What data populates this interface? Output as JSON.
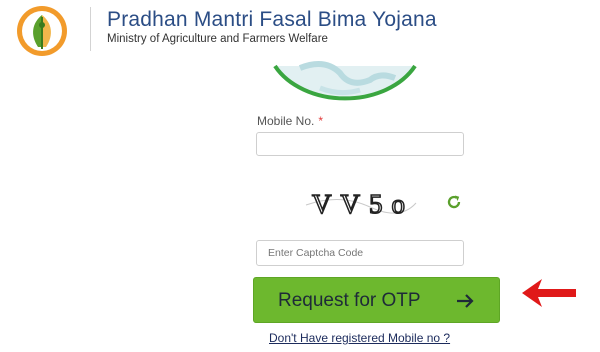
{
  "header": {
    "title": "Pradhan Mantri Fasal Bima Yojana",
    "subtitle": "Ministry of Agriculture and Farmers Welfare"
  },
  "form": {
    "mobile_label": "Mobile No.",
    "required_marker": "*",
    "mobile_value": "",
    "captcha_text": "VV5o",
    "captcha_placeholder": "Enter Captcha Code",
    "request_otp_label": "Request for OTP",
    "no_mobile_link": "Don't Have registered Mobile no ?"
  },
  "icons": {
    "logo": "pmfby-logo",
    "refresh": "refresh-icon",
    "arrow": "arrow-right-icon",
    "annotation": "red-arrow-icon"
  },
  "colors": {
    "brand_blue": "#2b4d85",
    "button_green": "#6db82e",
    "annotation_red": "#e01919"
  }
}
